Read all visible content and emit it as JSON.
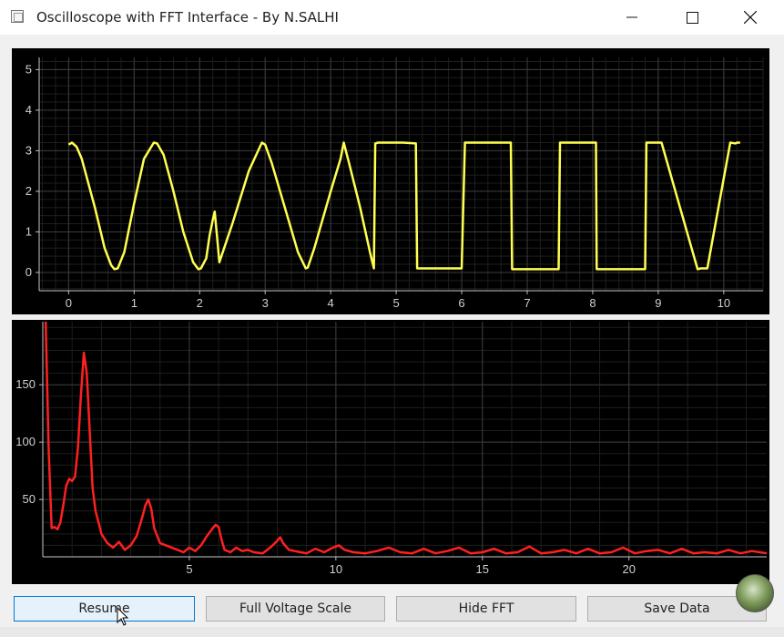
{
  "window": {
    "title": "Oscilloscope with FFT Interface - By N.SALHI"
  },
  "colors": {
    "scope_trace": "#ffff50",
    "fft_trace": "#ff2020",
    "plot_bg": "#000000",
    "grid": "#3c3c3c"
  },
  "icons": {
    "minimize": "minimize-icon",
    "maximize": "maximize-icon",
    "close": "close-icon",
    "app": "app-icon"
  },
  "buttons": {
    "resume": "Resume",
    "full_voltage_scale": "Full Voltage Scale",
    "hide_fft": "Hide FFT",
    "save_data": "Save Data"
  },
  "chart_data": [
    {
      "type": "line",
      "title": "",
      "xlabel": "",
      "ylabel": "",
      "xlim": [
        -0.45,
        10.6
      ],
      "ylim": [
        -0.45,
        5.3
      ],
      "xticks": [
        "0",
        "1",
        "2",
        "3",
        "4",
        "5",
        "6",
        "7",
        "8",
        "9",
        "10"
      ],
      "yticks": [
        "0",
        "1",
        "2",
        "3",
        "4",
        "5"
      ],
      "grid": true,
      "series": [
        {
          "x": [
            0,
            0.05,
            0.12,
            0.2,
            0.25,
            0.4,
            0.55,
            0.65,
            0.7,
            0.75,
            0.85,
            1.0,
            1.15,
            1.3,
            1.35,
            1.45,
            1.6,
            1.75,
            1.9,
            1.98,
            2.02,
            2.1,
            2.15,
            2.2,
            2.23,
            2.27,
            2.3,
            2.5,
            2.75,
            2.95,
            3.0,
            3.1,
            3.3,
            3.5,
            3.62,
            3.65,
            3.75,
            4.0,
            4.15,
            4.2,
            4.28,
            4.45,
            4.6,
            4.66,
            4.68,
            4.72,
            5.1,
            5.3,
            5.32,
            5.8,
            6.0,
            6.05,
            6.55,
            6.75,
            6.77,
            7.2,
            7.48,
            7.5,
            7.95,
            8.05,
            8.06,
            8.65,
            8.8,
            8.82,
            9.05,
            9.05,
            9.6,
            9.65,
            9.75,
            10.1,
            10.18,
            10.2,
            10.25
          ],
          "y": [
            3.15,
            3.2,
            3.1,
            2.8,
            2.5,
            1.6,
            0.6,
            0.18,
            0.08,
            0.1,
            0.5,
            1.7,
            2.8,
            3.2,
            3.18,
            2.9,
            2.0,
            1.0,
            0.25,
            0.08,
            0.1,
            0.35,
            0.9,
            1.3,
            1.5,
            0.8,
            0.25,
            1.2,
            2.5,
            3.2,
            3.15,
            2.7,
            1.6,
            0.5,
            0.1,
            0.12,
            0.6,
            2.0,
            2.8,
            3.2,
            2.7,
            1.6,
            0.5,
            0.1,
            3.18,
            3.2,
            3.2,
            3.18,
            0.1,
            0.1,
            0.1,
            3.2,
            3.2,
            3.2,
            0.08,
            0.08,
            0.08,
            3.2,
            3.2,
            3.2,
            0.08,
            0.08,
            0.08,
            3.2,
            3.2,
            3.2,
            0.08,
            0.1,
            0.1,
            3.2,
            3.18,
            3.2,
            3.2
          ]
        }
      ]
    },
    {
      "type": "line",
      "title": "",
      "xlabel": "",
      "ylabel": "",
      "xlim": [
        0,
        24.7
      ],
      "ylim": [
        0,
        205
      ],
      "xticks": [
        "5",
        "10",
        "15",
        "20"
      ],
      "yticks": [
        "50",
        "100",
        "150"
      ],
      "grid": true,
      "series": [
        {
          "x": [
            0.1,
            0.2,
            0.3,
            0.4,
            0.5,
            0.6,
            0.7,
            0.8,
            0.9,
            1.0,
            1.1,
            1.2,
            1.3,
            1.4,
            1.5,
            1.6,
            1.7,
            1.8,
            1.9,
            2.0,
            2.2,
            2.4,
            2.6,
            2.8,
            3.0,
            3.2,
            3.4,
            3.5,
            3.6,
            3.7,
            3.8,
            4.0,
            4.2,
            4.4,
            4.6,
            4.8,
            5.0,
            5.2,
            5.4,
            5.6,
            5.8,
            5.9,
            6.0,
            6.1,
            6.2,
            6.4,
            6.6,
            6.8,
            7.0,
            7.2,
            7.5,
            7.8,
            8.0,
            8.1,
            8.2,
            8.4,
            8.6,
            8.8,
            9.0,
            9.3,
            9.6,
            9.9,
            10.1,
            10.3,
            10.6,
            11.0,
            11.4,
            11.8,
            12.2,
            12.6,
            13.0,
            13.4,
            13.8,
            14.2,
            14.6,
            15.0,
            15.4,
            15.8,
            16.2,
            16.6,
            17.0,
            17.4,
            17.8,
            18.2,
            18.6,
            19.0,
            19.4,
            19.8,
            20.2,
            20.6,
            21.0,
            21.4,
            21.8,
            22.2,
            22.6,
            23.0,
            23.4,
            23.8,
            24.2,
            24.7
          ],
          "y": [
            205,
            95,
            25,
            26,
            24,
            30,
            45,
            62,
            68,
            66,
            70,
            95,
            140,
            178,
            160,
            110,
            60,
            40,
            30,
            20,
            12,
            8,
            13,
            6,
            10,
            18,
            35,
            45,
            50,
            42,
            25,
            12,
            10,
            8,
            6,
            4,
            8,
            5,
            10,
            18,
            25,
            28,
            26,
            15,
            6,
            4,
            8,
            5,
            6,
            4,
            3,
            9,
            14,
            17,
            12,
            6,
            5,
            4,
            3,
            7,
            4,
            8,
            10,
            6,
            4,
            3,
            5,
            8,
            4,
            3,
            7,
            3,
            5,
            8,
            3,
            4,
            7,
            3,
            4,
            9,
            3,
            4,
            6,
            3,
            7,
            3,
            4,
            8,
            3,
            5,
            6,
            3,
            7,
            3,
            4,
            3,
            6,
            3,
            5,
            3
          ]
        }
      ]
    }
  ]
}
